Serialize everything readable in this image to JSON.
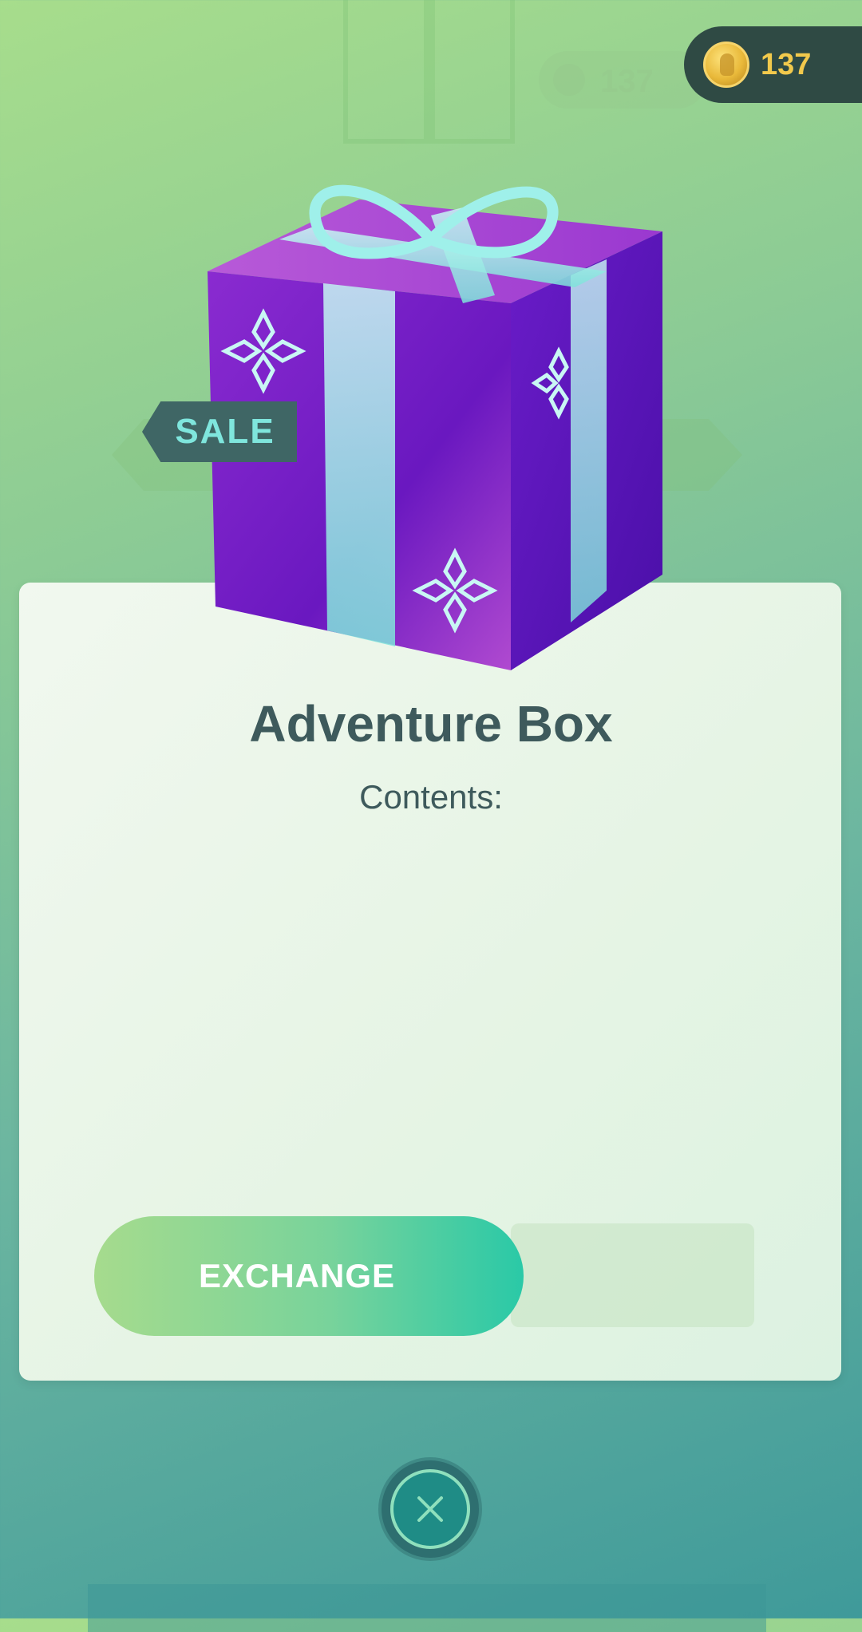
{
  "header": {
    "coin_amount": "137",
    "coin_icon": "pokecoin-icon"
  },
  "item": {
    "sale_badge": "SALE",
    "title": "Adventure Box",
    "contents_label": "Contents:",
    "image": "gift-box-icon"
  },
  "actions": {
    "exchange_label": "EXCHANGE",
    "close_icon": "close-icon"
  },
  "colors": {
    "accent_teal": "#2ac9a7",
    "coin_gold": "#f2c94c",
    "title_text": "#3e5a5c"
  }
}
